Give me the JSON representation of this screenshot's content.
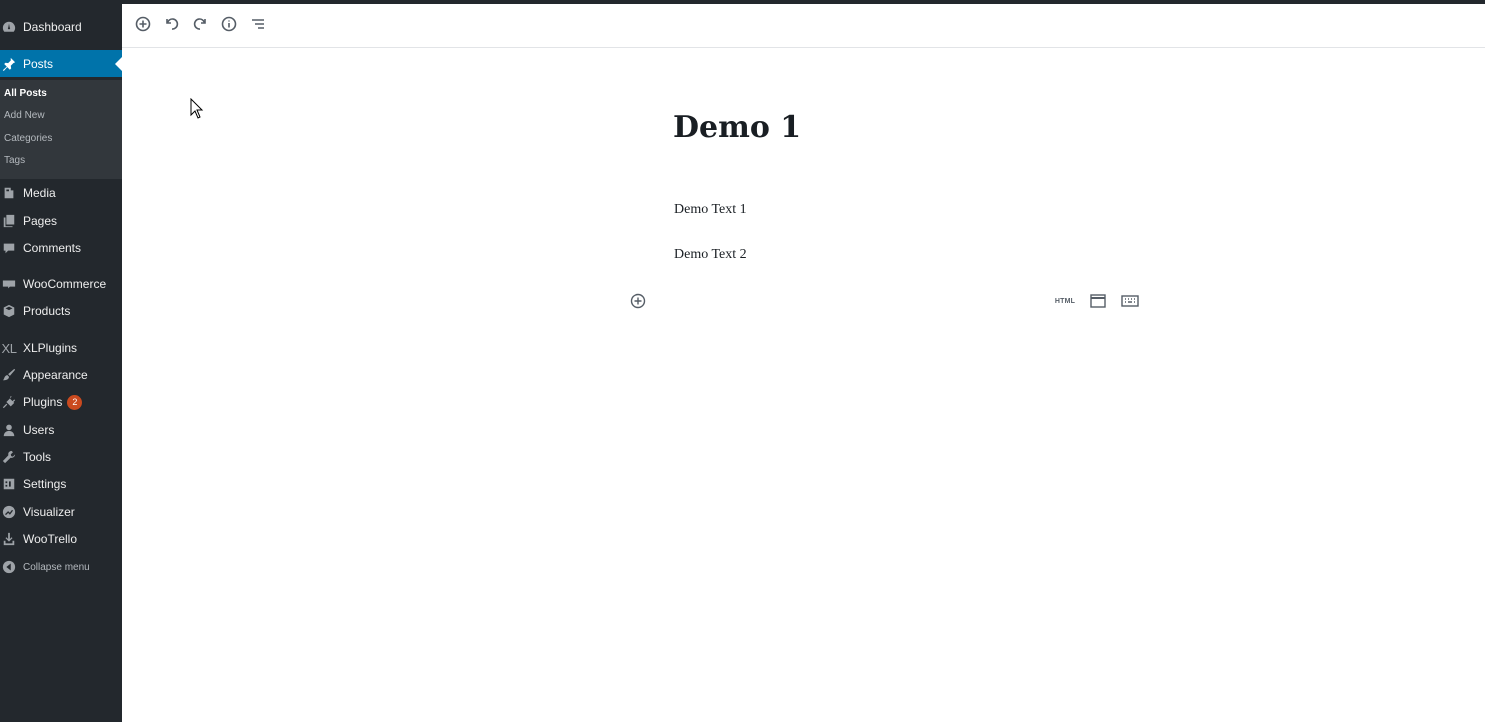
{
  "sidebar": {
    "items": [
      {
        "id": "dashboard",
        "label": "Dashboard",
        "icon": "dashboard-icon"
      },
      {
        "id": "posts",
        "label": "Posts",
        "icon": "pin-icon",
        "active": true
      },
      {
        "id": "media",
        "label": "Media",
        "icon": "media-icon"
      },
      {
        "id": "pages",
        "label": "Pages",
        "icon": "pages-icon"
      },
      {
        "id": "comments",
        "label": "Comments",
        "icon": "comment-icon"
      },
      {
        "id": "woocommerce",
        "label": "WooCommerce",
        "icon": "woo-icon"
      },
      {
        "id": "products",
        "label": "Products",
        "icon": "products-icon"
      },
      {
        "id": "xlplugins",
        "label": "XLPlugins",
        "icon": "xl-icon",
        "icon_text": "XL"
      },
      {
        "id": "appearance",
        "label": "Appearance",
        "icon": "brush-icon"
      },
      {
        "id": "plugins",
        "label": "Plugins",
        "icon": "plug-icon",
        "badge": "2"
      },
      {
        "id": "users",
        "label": "Users",
        "icon": "user-icon"
      },
      {
        "id": "tools",
        "label": "Tools",
        "icon": "wrench-icon"
      },
      {
        "id": "settings",
        "label": "Settings",
        "icon": "settings-icon"
      },
      {
        "id": "visualizer",
        "label": "Visualizer",
        "icon": "chart-icon"
      },
      {
        "id": "wootrello",
        "label": "WooTrello",
        "icon": "upload-icon"
      }
    ],
    "submenu": [
      {
        "label": "All Posts",
        "current": true
      },
      {
        "label": "Add New"
      },
      {
        "label": "Categories"
      },
      {
        "label": "Tags"
      }
    ],
    "collapse_label": "Collapse menu"
  },
  "toolbar": {
    "buttons": [
      "add-block-icon",
      "undo-icon",
      "redo-icon",
      "info-icon",
      "list-view-icon"
    ]
  },
  "post": {
    "title": "Demo 1",
    "paragraphs": [
      "Demo Text 1",
      "Demo Text 2"
    ]
  },
  "block_shortcuts": {
    "html_label": "HTML"
  },
  "colors": {
    "sidebar_bg": "#23282d",
    "submenu_bg": "#32373c",
    "active_bg": "#0073aa",
    "badge_bg": "#ca4a1f"
  }
}
